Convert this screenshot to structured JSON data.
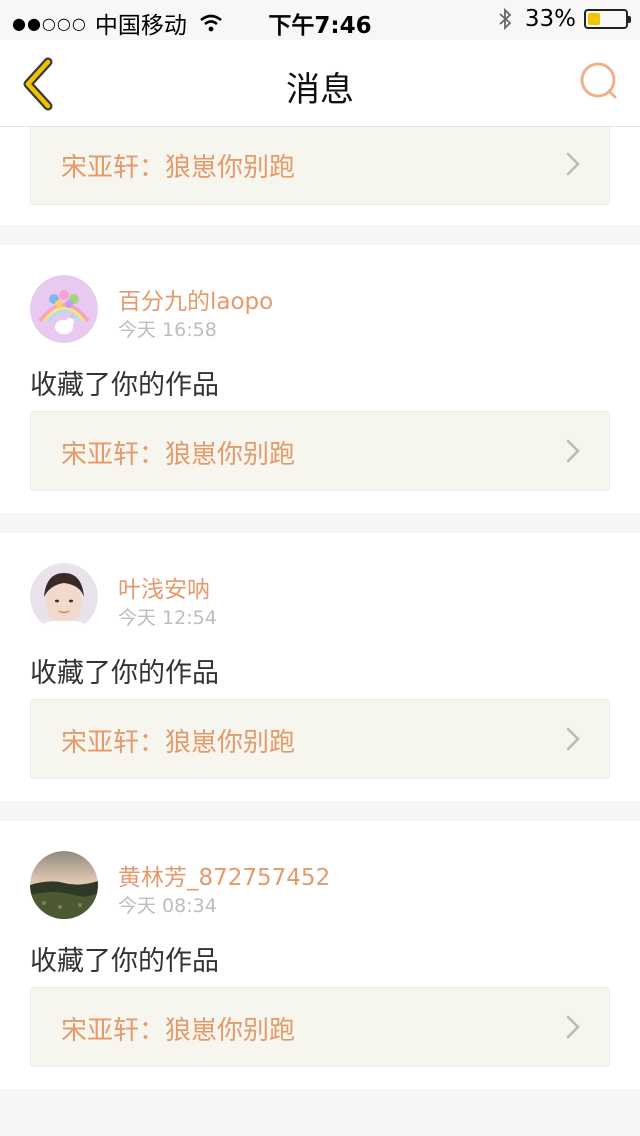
{
  "status_bar": {
    "signal": "●●○○○",
    "carrier": "中国移动",
    "time": "下午7:46",
    "battery_percent": "33%",
    "battery_level": 0.33,
    "battery_color": "#f2c400"
  },
  "nav": {
    "title": "消息",
    "back_icon": "chevron-left-icon",
    "search_icon": "search-icon",
    "accent_color": "#f2c400"
  },
  "top_card": {
    "work_title": "宋亚轩：狼崽你别跑"
  },
  "messages": [
    {
      "username": "百分九的laopo",
      "time": "今天 16:58",
      "action": "收藏了你的作品",
      "work_title": "宋亚轩：狼崽你别跑"
    },
    {
      "username": "叶浅安呐",
      "time": "今天 12:54",
      "action": "收藏了你的作品",
      "work_title": "宋亚轩：狼崽你别跑"
    },
    {
      "username": "黄林芳_872757452",
      "time": "今天 08:34",
      "action": "收藏了你的作品",
      "work_title": "宋亚轩：狼崽你别跑"
    }
  ],
  "colors": {
    "username": "#e59a6c",
    "timestamp": "#bdbdbd",
    "link_background": "#f6f6ee"
  }
}
